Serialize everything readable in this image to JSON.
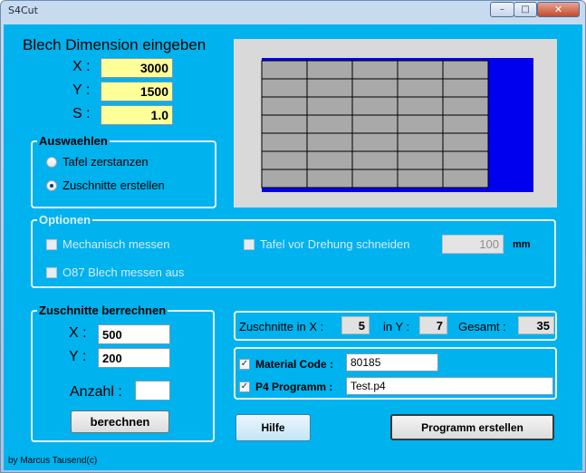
{
  "window": {
    "title": "S4Cut",
    "min": "–",
    "max": "□",
    "close": "✕"
  },
  "sheet": {
    "heading": "Blech Dimension eingeben",
    "x_label": "X :",
    "x_value": "3000",
    "y_label": "Y :",
    "y_value": "1500",
    "s_label": "S :",
    "s_value": "1.0"
  },
  "selection": {
    "title": "Auswaehlen",
    "option1": "Tafel zerstanzen",
    "option2": "Zuschnitte erstellen",
    "selected": 2
  },
  "preview": {
    "columns": 5,
    "rows": 7,
    "grid_color": "#a9a9a9",
    "border_color": "#0000ee",
    "frame_color": "#d9d9d9"
  },
  "options": {
    "title": "Optionen",
    "measure": "Mechanisch messen",
    "cut_before_turn": "Tafel vor Drehung schneiden",
    "turn_value": "100",
    "unit": "mm",
    "o87": "O87 Blech messen aus"
  },
  "calc": {
    "title": "Zuschnitte berrechnen",
    "x_label": "X :",
    "x_value": "500",
    "y_label": "Y :",
    "y_value": "200",
    "count_label": "Anzahl :",
    "count_value": "",
    "button": "berechnen"
  },
  "result": {
    "x_label": "Zuschnitte in X :",
    "x_value": "5",
    "y_label": "in Y :",
    "y_value": "7",
    "total_label": "Gesamt :",
    "total_value": "35"
  },
  "material": {
    "code_label": "Material Code :",
    "code_value": "80185",
    "code_checked": true,
    "program_label": "P4 Programm :",
    "program_value": "Test.p4",
    "program_checked": true
  },
  "buttons": {
    "help": "Hilfe",
    "create": "Programm erstellen"
  },
  "footer": "by Marcus Tausend(c)"
}
